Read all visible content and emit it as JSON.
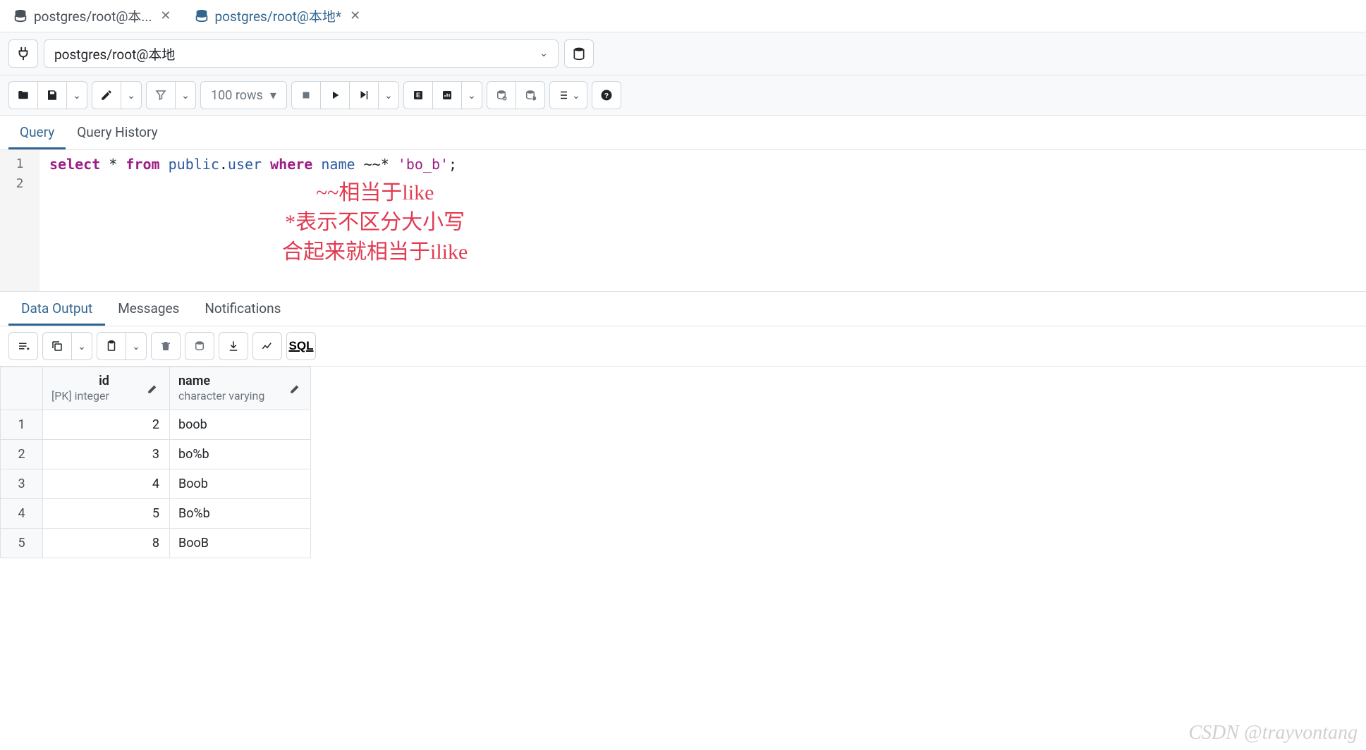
{
  "tabs": [
    {
      "label": "postgres/root@本...",
      "active": false
    },
    {
      "label": "postgres/root@本地*",
      "active": true
    }
  ],
  "connection": {
    "value": "postgres/root@本地"
  },
  "row_limit": "100 rows",
  "editor_tabs": {
    "query": "Query",
    "history": "Query History"
  },
  "sql": {
    "kw_select": "select",
    "star": "*",
    "kw_from": "from",
    "schema": "public",
    "dot": ".",
    "table": "user",
    "kw_where": "where",
    "col": "name",
    "op": "~~*",
    "literal": "'bo_b'",
    "semi": ";"
  },
  "line_numbers": [
    "1",
    "2"
  ],
  "annotation": {
    "l1": "~~相当于like",
    "l2": "*表示不区分大小写",
    "l3": "合起来就相当于ilike"
  },
  "result_tabs": {
    "data": "Data Output",
    "messages": "Messages",
    "notifications": "Notifications"
  },
  "sql_button": "SQL",
  "columns": [
    {
      "name": "id",
      "type": "[PK] integer"
    },
    {
      "name": "name",
      "type": "character varying"
    }
  ],
  "rows": [
    {
      "n": "1",
      "id": "2",
      "name": "boob"
    },
    {
      "n": "2",
      "id": "3",
      "name": "bo%b"
    },
    {
      "n": "3",
      "id": "4",
      "name": "Boob"
    },
    {
      "n": "4",
      "id": "5",
      "name": "Bo%b"
    },
    {
      "n": "5",
      "id": "8",
      "name": "BooB"
    }
  ],
  "watermark": "CSDN @trayvontang"
}
